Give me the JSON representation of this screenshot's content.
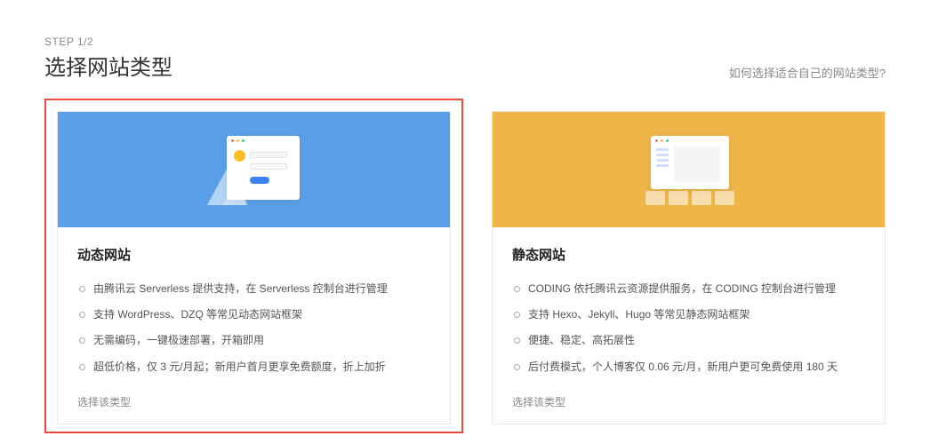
{
  "header": {
    "step": "STEP 1/2",
    "title": "选择网站类型",
    "help_link": "如何选择适合自己的网站类型?"
  },
  "cards": [
    {
      "title": "动态网站",
      "features": [
        "由腾讯云 Serverless 提供支持，在 Serverless 控制台进行管理",
        "支持 WordPress、DZQ 等常见动态网站框架",
        "无需编码，一键极速部署，开箱即用",
        "超低价格，仅 3 元/月起；新用户首月更享免费额度，折上加折"
      ],
      "action": "选择该类型",
      "selected": true
    },
    {
      "title": "静态网站",
      "features": [
        "CODING 依托腾讯云资源提供服务，在 CODING 控制台进行管理",
        "支持 Hexo、Jekyll、Hugo 等常见静态网站框架",
        "便捷、稳定、高拓展性",
        "后付费模式，个人博客仅 0.06 元/月，新用户更可免费使用 180 天"
      ],
      "action": "选择该类型",
      "selected": false
    }
  ]
}
